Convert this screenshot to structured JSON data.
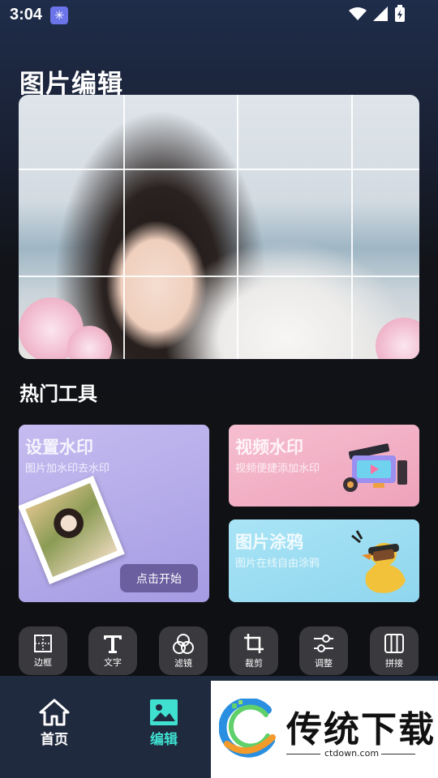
{
  "status_bar": {
    "time": "3:04"
  },
  "page": {
    "title": "图片编辑"
  },
  "hot_tools": {
    "title": "热门工具",
    "watermark": {
      "title": "设置水印",
      "subtitle": "图片加水印去水印",
      "button": "点击开始"
    },
    "video_watermark": {
      "title": "视频水印",
      "subtitle": "视频便捷添加水印"
    },
    "doodle": {
      "title": "图片涂鸦",
      "subtitle": "图片在线自由涂鸦"
    }
  },
  "tools": [
    {
      "label": "边框",
      "icon": "border-icon"
    },
    {
      "label": "文字",
      "icon": "text-icon"
    },
    {
      "label": "滤镜",
      "icon": "filter-icon"
    },
    {
      "label": "裁剪",
      "icon": "crop-icon"
    },
    {
      "label": "调整",
      "icon": "adjust-icon"
    },
    {
      "label": "拼接",
      "icon": "collage-icon"
    }
  ],
  "bottom_nav": {
    "home": "首页",
    "edit": "编辑",
    "active": "edit",
    "active_color": "#3fe0d0"
  },
  "ad": {
    "brand": "传统下载",
    "domain": "ctdown.com"
  }
}
